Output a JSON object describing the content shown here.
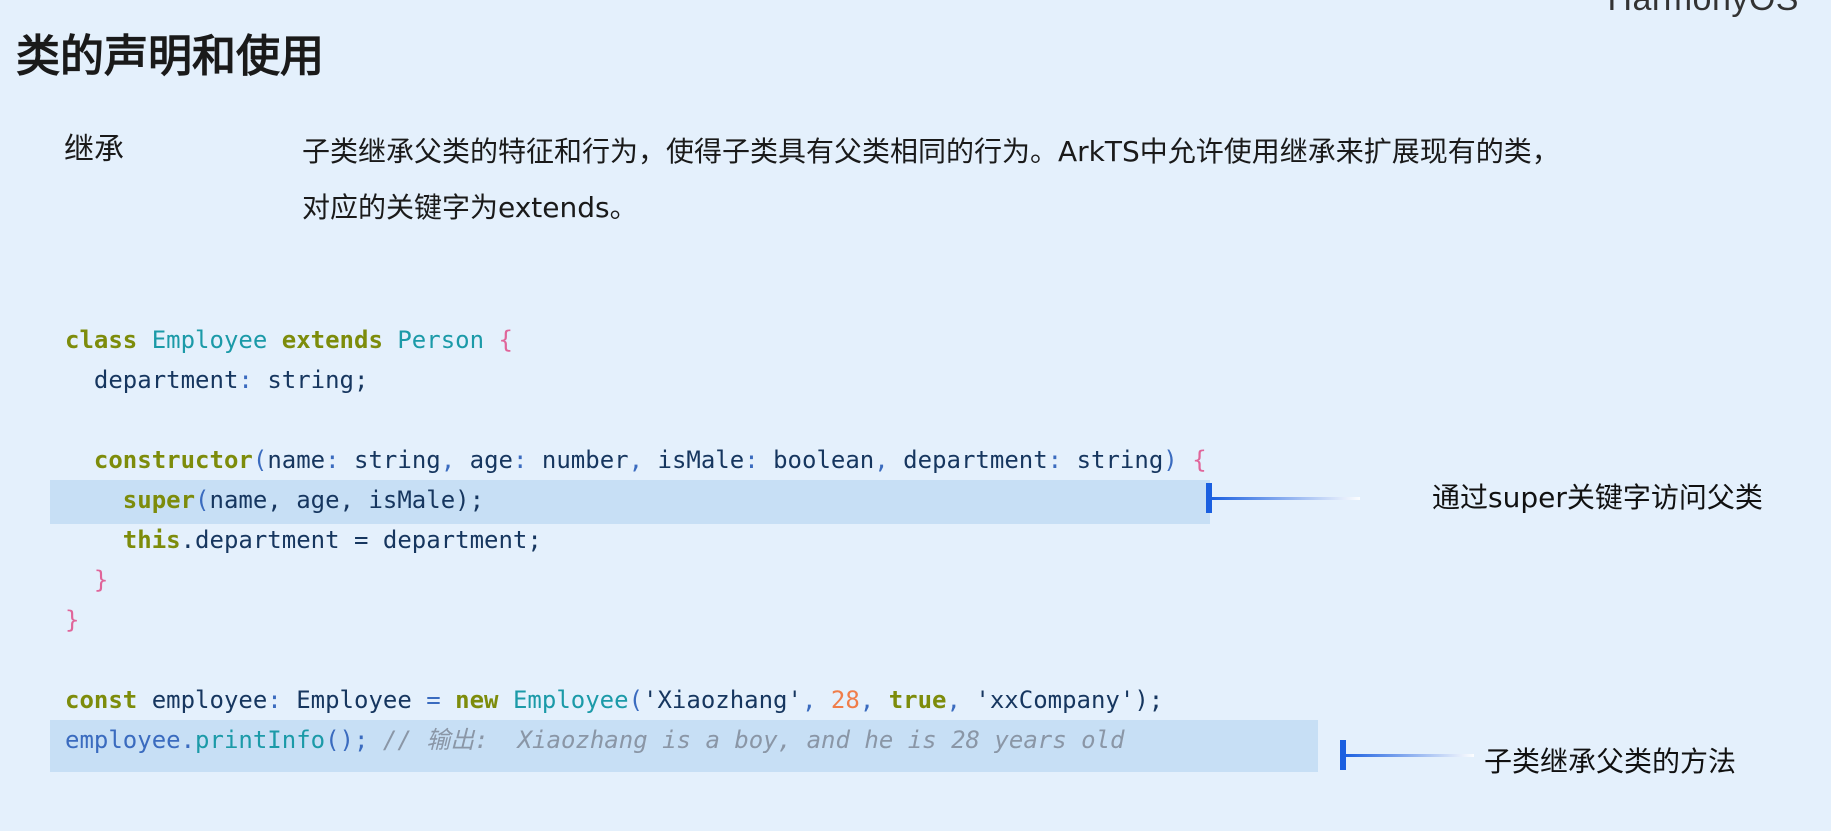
{
  "brand": "HarmonyOS",
  "title": "类的声明和使用",
  "section_label": "继承",
  "description": [
    "子类继承父类的特征和行为，使得子类具有父类相同的行为。ArkTS中允许使用继承来扩展现有的类，",
    "对应的关键字为extends。"
  ],
  "code": {
    "line1": {
      "kw": "class",
      "cls": "Employee",
      "kw2": "extends",
      "cls2": "Person",
      "br": "{"
    },
    "line2": {
      "id": "department",
      "p1": ":",
      "type": "string",
      "p2": ";"
    },
    "line4": {
      "kw": "constructor",
      "p1": "(",
      "a1": "name",
      "c1": ":",
      "t1": "string",
      "s1": ",",
      "a2": "age",
      "c2": ":",
      "t2": "number",
      "s2": ",",
      "a3": "isMale",
      "c3": ":",
      "t3": "boolean",
      "s3": ",",
      "a4": "department",
      "c4": ":",
      "t4": "string",
      "p2": ")",
      "br": "{"
    },
    "line5": {
      "kw": "super",
      "p1": "(",
      "args": "name, age, isMale",
      "p2": ");"
    },
    "line6": {
      "kw": "this",
      "rest": ".department = department;"
    },
    "line7": {
      "br": "}"
    },
    "line8": {
      "br": "}"
    },
    "line10": {
      "kw": "const",
      "id": "employee",
      "p1": ":",
      "type": "Employee",
      "eq": "=",
      "kw2": "new",
      "cls": "Employee",
      "p2": "(",
      "s1": "'Xiaozhang'",
      "c1": ",",
      "n1": "28",
      "c2": ",",
      "b1": "true",
      "c3": ",",
      "s2": "'xxCompany'",
      "p3": ");"
    },
    "line11": {
      "id": "employee",
      "dot": ".",
      "method": "printInfo",
      "p1": "();",
      "comment": "// 输出:  Xiaozhang is a boy, and he is 28 years old"
    }
  },
  "notes": {
    "super_note": "通过super关键字访问父类",
    "method_note": "子类继承父类的方法"
  },
  "colors": {
    "background": "#e4f0fc",
    "highlight": "#c7dff5",
    "marker": "#1a5fe0",
    "keyword": "#7d8c0b"
  }
}
